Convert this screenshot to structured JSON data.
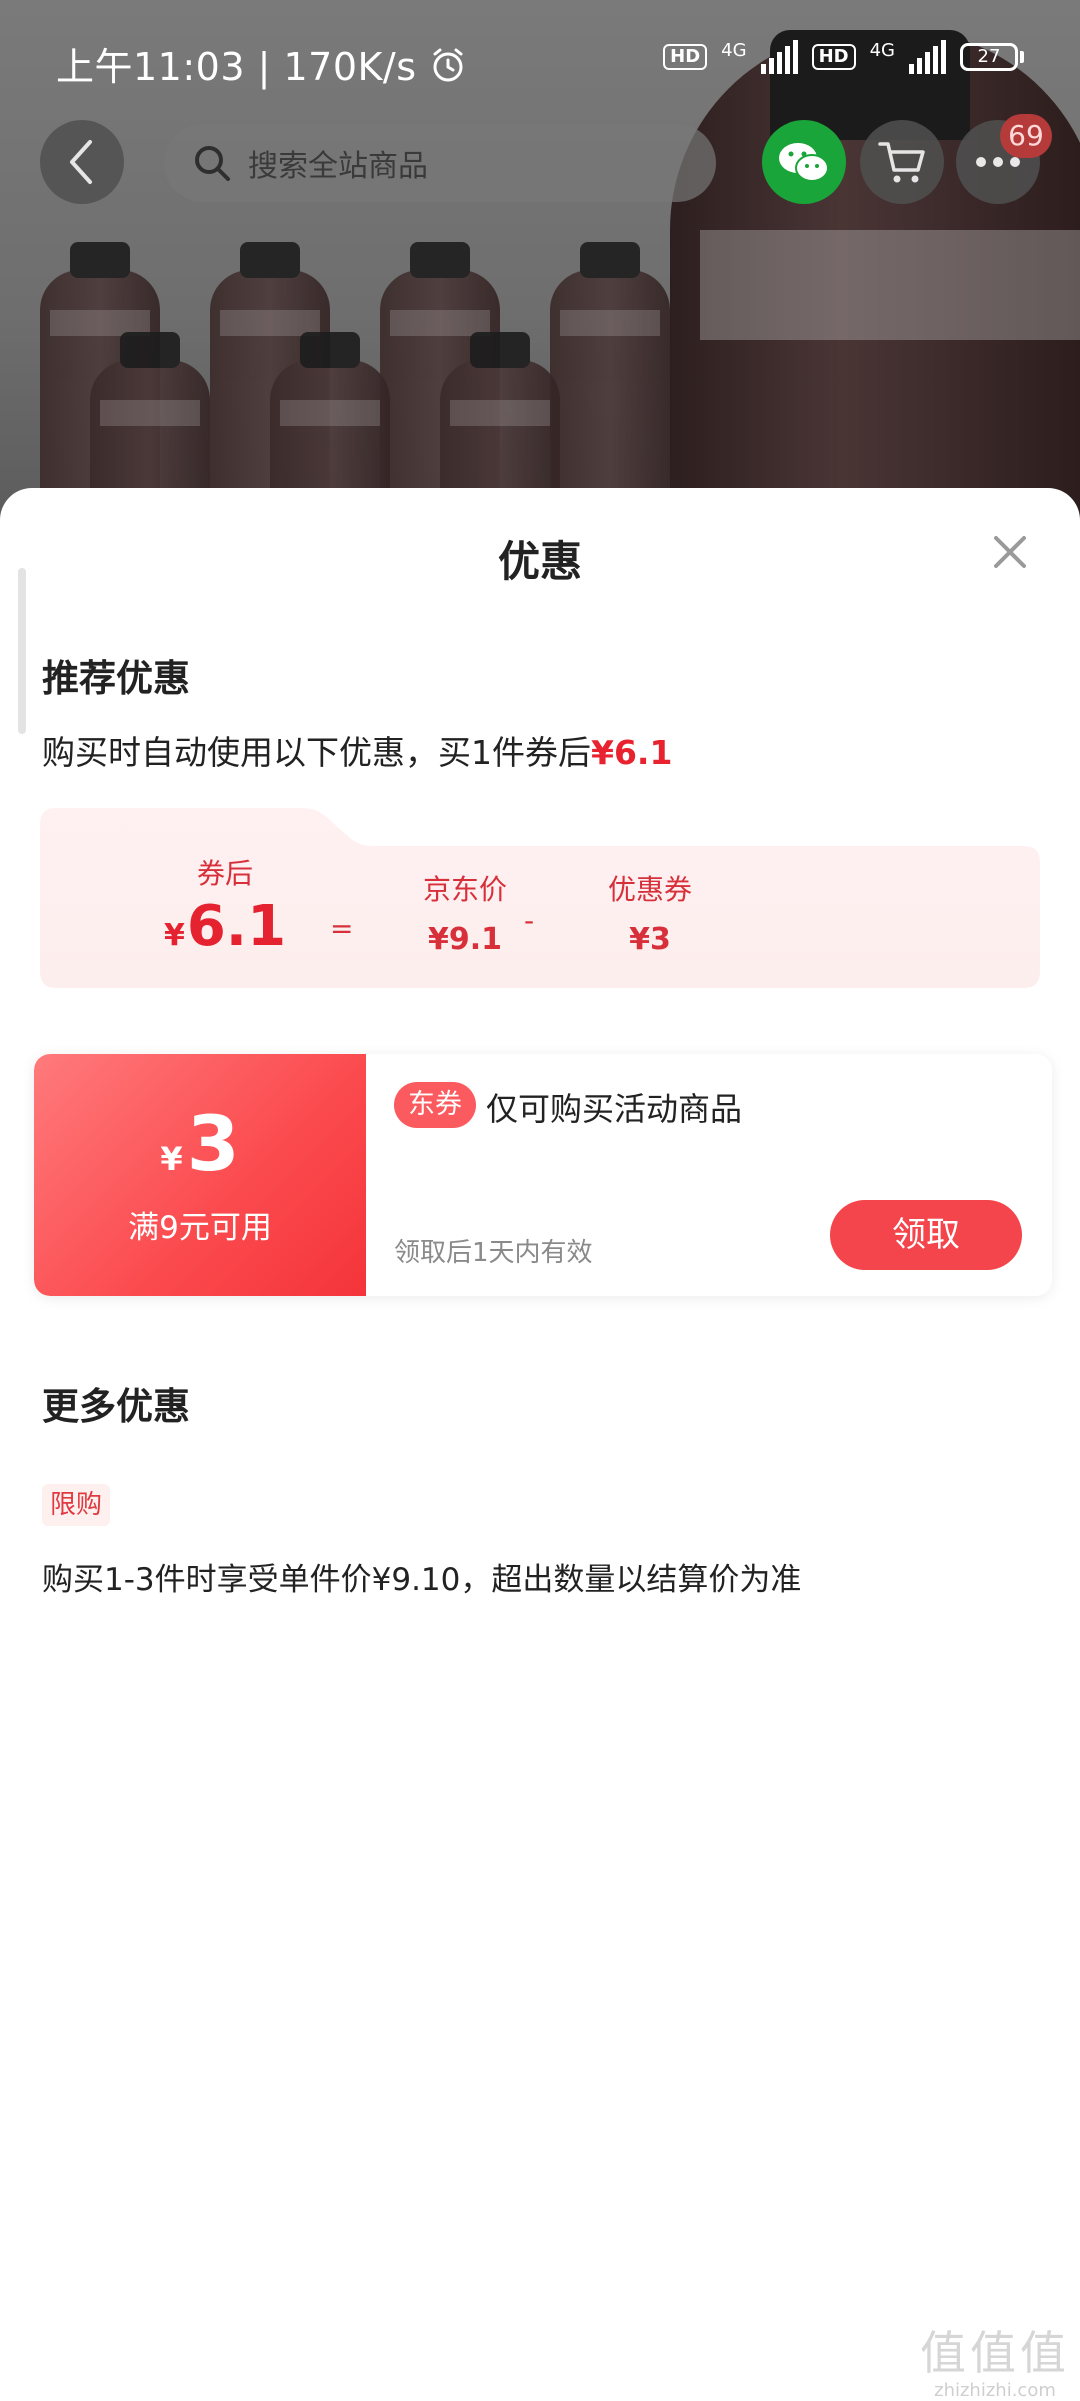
{
  "status_bar": {
    "time": "上午11:03",
    "speed": "170K/s",
    "hd_label": "HD",
    "network_1": "4G",
    "network_2": "4G",
    "battery": "27"
  },
  "nav": {
    "search_placeholder": "搜索全站商品",
    "badge_count": "69"
  },
  "sheet": {
    "title": "优惠",
    "recommend": {
      "title": "推荐优惠",
      "desc_prefix": "购买时自动使用以下优惠，买1件券后",
      "desc_price": "¥6.1",
      "breakdown": {
        "after_label": "券后",
        "after_currency": "¥",
        "after_value": "6.1",
        "equals": "=",
        "jd_label": "京东价",
        "jd_value": "¥9.1",
        "minus": "-",
        "coupon_label": "优惠券",
        "coupon_value": "¥3"
      }
    },
    "coupon": {
      "currency": "¥",
      "amount": "3",
      "condition": "满9元可用",
      "tag": "东券",
      "scope": "仅可购买活动商品",
      "validity": "领取后1天内有效",
      "button": "领取"
    },
    "more": {
      "title": "更多优惠",
      "tag": "限购",
      "desc": "购买1-3件时享受单件价¥9.10，超出数量以结算价为准"
    }
  },
  "watermark": {
    "logo": "值值值",
    "text": "zhizhizhi.com"
  },
  "colors": {
    "accent_red": "#e8222f",
    "coupon_red": "#fb4a4e",
    "wechat_green": "#19a53a"
  }
}
